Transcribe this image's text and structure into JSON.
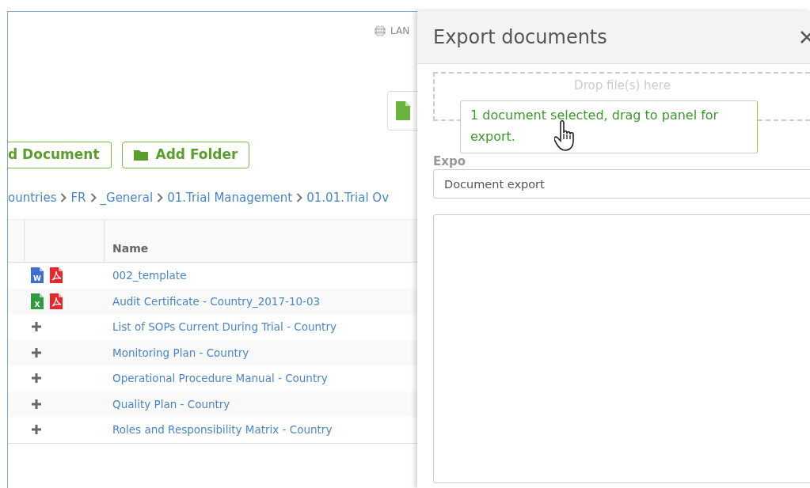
{
  "header": {
    "language_label": "LAN"
  },
  "toolbar": {
    "buttons": [
      {
        "label": "d Document",
        "kind": "document"
      },
      {
        "label": "Add Folder",
        "kind": "folder"
      }
    ]
  },
  "breadcrumb": [
    "ountries",
    "FR",
    "_General",
    "01.Trial Management",
    "01.01.Trial Ov"
  ],
  "table": {
    "columns": [
      "Name"
    ],
    "rows": [
      {
        "name": "002_template",
        "files": [
          {
            "kind": "word",
            "letter": "W"
          },
          {
            "kind": "pdf"
          }
        ]
      },
      {
        "name": "Audit Certificate - Country_2017-10-03",
        "files": [
          {
            "kind": "excel",
            "letter": "X"
          },
          {
            "kind": "pdf"
          }
        ]
      },
      {
        "name": "List of SOPs Current During Trial - Country",
        "files": []
      },
      {
        "name": "Monitoring Plan - Country",
        "files": []
      },
      {
        "name": "Operational Procedure Manual - Country",
        "files": []
      },
      {
        "name": "Quality Plan - Country",
        "files": []
      },
      {
        "name": "Roles and Responsibility Matrix - Country",
        "files": []
      }
    ]
  },
  "export_panel": {
    "title": "Export documents",
    "drop_zone": "Drop file(s) here",
    "name_label": "Expo",
    "name_value": "Document export"
  },
  "drag_tooltip": "1 document selected, drag to panel for export."
}
